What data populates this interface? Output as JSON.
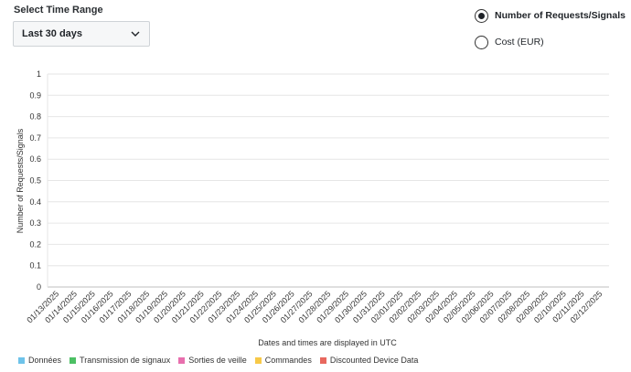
{
  "controls": {
    "range_label": "Select Time Range",
    "range_value": "Last 30 days"
  },
  "metric_options": [
    {
      "label": "Number of Requests/Signals",
      "checked": true
    },
    {
      "label": "Cost (EUR)",
      "checked": false
    }
  ],
  "chart_data": {
    "type": "bar",
    "ylabel": "Number of Requests/Signals",
    "xlabel": "Dates and times are displayed in UTC",
    "ylim": [
      0,
      1
    ],
    "yticks": [
      "0",
      "0.1",
      "0.2",
      "0.3",
      "0.4",
      "0.5",
      "0.6",
      "0.7",
      "0.8",
      "0.9",
      "1"
    ],
    "categories": [
      "01/13/2025",
      "01/14/2025",
      "01/15/2025",
      "01/16/2025",
      "01/17/2025",
      "01/18/2025",
      "01/19/2025",
      "01/20/2025",
      "01/21/2025",
      "01/22/2025",
      "01/23/2025",
      "01/24/2025",
      "01/25/2025",
      "01/26/2025",
      "01/27/2025",
      "01/28/2025",
      "01/29/2025",
      "01/30/2025",
      "01/31/2025",
      "02/01/2025",
      "02/02/2025",
      "02/03/2025",
      "02/04/2025",
      "02/05/2025",
      "02/06/2025",
      "02/07/2025",
      "02/08/2025",
      "02/09/2025",
      "02/10/2025",
      "02/11/2025",
      "02/12/2025"
    ],
    "series": [
      {
        "name": "Données",
        "color": "#6ec3ea",
        "values": [
          0,
          0,
          0,
          0,
          0,
          0,
          0,
          0,
          0,
          0,
          0,
          0,
          0,
          0,
          0,
          0,
          0,
          0,
          0,
          0,
          0,
          0,
          0,
          0,
          0,
          0,
          0,
          0,
          0,
          0,
          0
        ]
      },
      {
        "name": "Transmission de signaux",
        "color": "#4cc064",
        "values": [
          0,
          0,
          0,
          0,
          0,
          0,
          0,
          0,
          0,
          0,
          0,
          0,
          0,
          0,
          0,
          0,
          0,
          0,
          0,
          0,
          0,
          0,
          0,
          0,
          0,
          0,
          0,
          0,
          0,
          0,
          0
        ]
      },
      {
        "name": "Sorties de veille",
        "color": "#e86fae",
        "values": [
          0,
          0,
          0,
          0,
          0,
          0,
          0,
          0,
          0,
          0,
          0,
          0,
          0,
          0,
          0,
          0,
          0,
          0,
          0,
          0,
          0,
          0,
          0,
          0,
          0,
          0,
          0,
          0,
          0,
          0,
          0
        ]
      },
      {
        "name": "Commandes",
        "color": "#f7c948",
        "values": [
          0,
          0,
          0,
          0,
          0,
          0,
          0,
          0,
          0,
          0,
          0,
          0,
          0,
          0,
          0,
          0,
          0,
          0,
          0,
          0,
          0,
          0,
          0,
          0,
          0,
          0,
          0,
          0,
          0,
          0,
          0
        ]
      },
      {
        "name": "Discounted Device Data",
        "color": "#e8685e",
        "values": [
          0,
          0,
          0,
          0,
          0,
          0,
          0,
          0,
          0,
          0,
          0,
          0,
          0,
          0,
          0,
          0,
          0,
          0,
          0,
          0,
          0,
          0,
          0,
          0,
          0,
          0,
          0,
          0,
          0,
          0,
          0
        ]
      }
    ],
    "grid": true,
    "legend_position": "bottom-left"
  }
}
